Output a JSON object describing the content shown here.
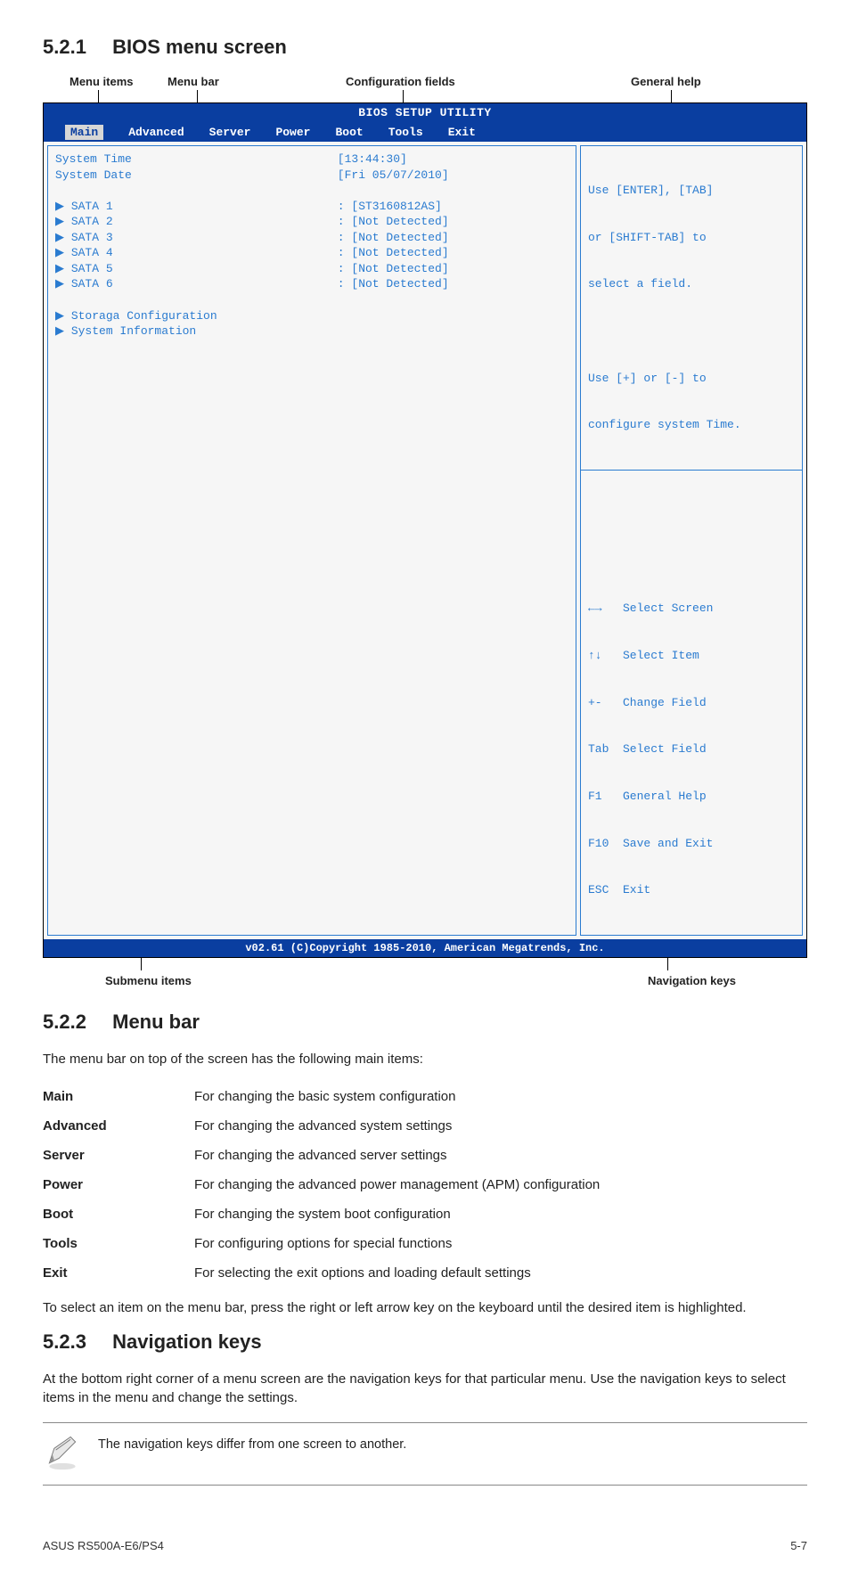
{
  "sections": {
    "s1": {
      "num": "5.2.1",
      "title": "BIOS menu screen"
    },
    "s2": {
      "num": "5.2.2",
      "title": "Menu bar"
    },
    "s3": {
      "num": "5.2.3",
      "title": "Navigation keys"
    }
  },
  "callouts": {
    "menu_items": "Menu items",
    "menu_bar": "Menu bar",
    "config_fields": "Configuration fields",
    "general_help": "General help",
    "submenu_items": "Submenu items",
    "nav_keys": "Navigation keys"
  },
  "bios": {
    "title": "BIOS SETUP UTILITY",
    "tabs": {
      "main": "Main",
      "advanced": "Advanced",
      "server": "Server",
      "power": "Power",
      "boot": "Boot",
      "tools": "Tools",
      "exit": "Exit"
    },
    "left_labels": {
      "sys_time": "System Time",
      "sys_date": "System Date",
      "sata1": "SATA 1",
      "sata2": "SATA 2",
      "sata3": "SATA 3",
      "sata4": "SATA 4",
      "sata5": "SATA 5",
      "sata6": "SATA 6",
      "storage": "Storaga Configuration",
      "sysinfo": "System Information"
    },
    "left_values": {
      "time": "[13:44:30]",
      "date": "[Fri 05/07/2010]",
      "sata1": "[ST3160812AS]",
      "sata2": "[Not Detected]",
      "sata3": "[Not Detected]",
      "sata4": "[Not Detected]",
      "sata5": "[Not Detected]",
      "sata6": "[Not Detected]"
    },
    "help": {
      "l1": "Use [ENTER], [TAB]",
      "l2": "or [SHIFT-TAB] to",
      "l3": "select a field.",
      "l4": "Use [+] or [-] to",
      "l5": "configure system Time."
    },
    "nav": {
      "l1": "←→   Select Screen",
      "l2": "↑↓   Select Item",
      "l3": "+-   Change Field",
      "l4": "Tab  Select Field",
      "l5": "F1   General Help",
      "l6": "F10  Save and Exit",
      "l7": "ESC  Exit"
    },
    "footer": "v02.61 (C)Copyright 1985-2010, American Megatrends, Inc."
  },
  "menu_bar_intro": "The menu bar on top of the screen has the following main items:",
  "defs": {
    "main": {
      "term": "Main",
      "desc": "For changing the basic system configuration"
    },
    "advanced": {
      "term": "Advanced",
      "desc": "For changing the advanced system settings"
    },
    "server": {
      "term": "Server",
      "desc": "For changing the advanced server settings"
    },
    "power": {
      "term": "Power",
      "desc": "For changing the advanced power management (APM) configuration"
    },
    "boot": {
      "term": "Boot",
      "desc": "For changing the system boot configuration"
    },
    "tools": {
      "term": "Tools",
      "desc": "For configuring options for special functions"
    },
    "exit": {
      "term": "Exit",
      "desc": "For selecting the exit options and loading default settings"
    }
  },
  "menu_bar_outro": "To select an item on the menu bar, press the right or left arrow key on the keyboard until the desired item is highlighted.",
  "nav_keys_text": "At the bottom right corner of a menu screen are the navigation keys for that particular menu. Use the navigation keys to select items in the menu and change the settings.",
  "note_text": "The navigation keys differ from one screen to another.",
  "footer": {
    "left": "ASUS RS500A-E6/PS4",
    "right": "5-7"
  }
}
